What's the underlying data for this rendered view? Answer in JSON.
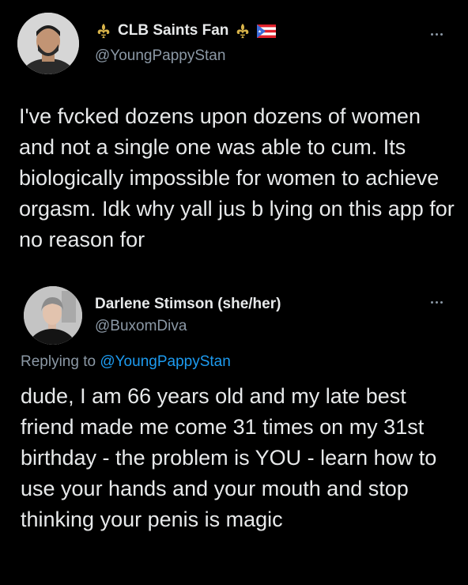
{
  "tweets": [
    {
      "display_name": "CLB Saints Fan",
      "handle": "@YoungPappyStan",
      "name_icons": [
        "fleur-de-lis-icon",
        "fleur-de-lis-icon",
        "puerto-rico-flag-icon"
      ],
      "text": "I've fvcked dozens upon dozens of women and not a single one was able to cum. Its biologically impossible for women to achieve orgasm. Idk why yall jus b lying on this app for no reason for"
    },
    {
      "display_name": "Darlene Stimson (she/her)",
      "handle": "@BuxomDiva",
      "replying_to_prefix": "Replying to",
      "replying_to_handle": "@YoungPappyStan",
      "text": "dude, I am 66 years old and my late best friend made me come 31 times on my 31st birthday - the problem is YOU - learn how to use your hands and your mouth and stop thinking your penis is magic"
    }
  ],
  "colors": {
    "background": "#000000",
    "primary_text": "#e7e9ea",
    "secondary_text": "#8b98a5",
    "link": "#1d9bf0",
    "gold": "#d9b44a"
  }
}
